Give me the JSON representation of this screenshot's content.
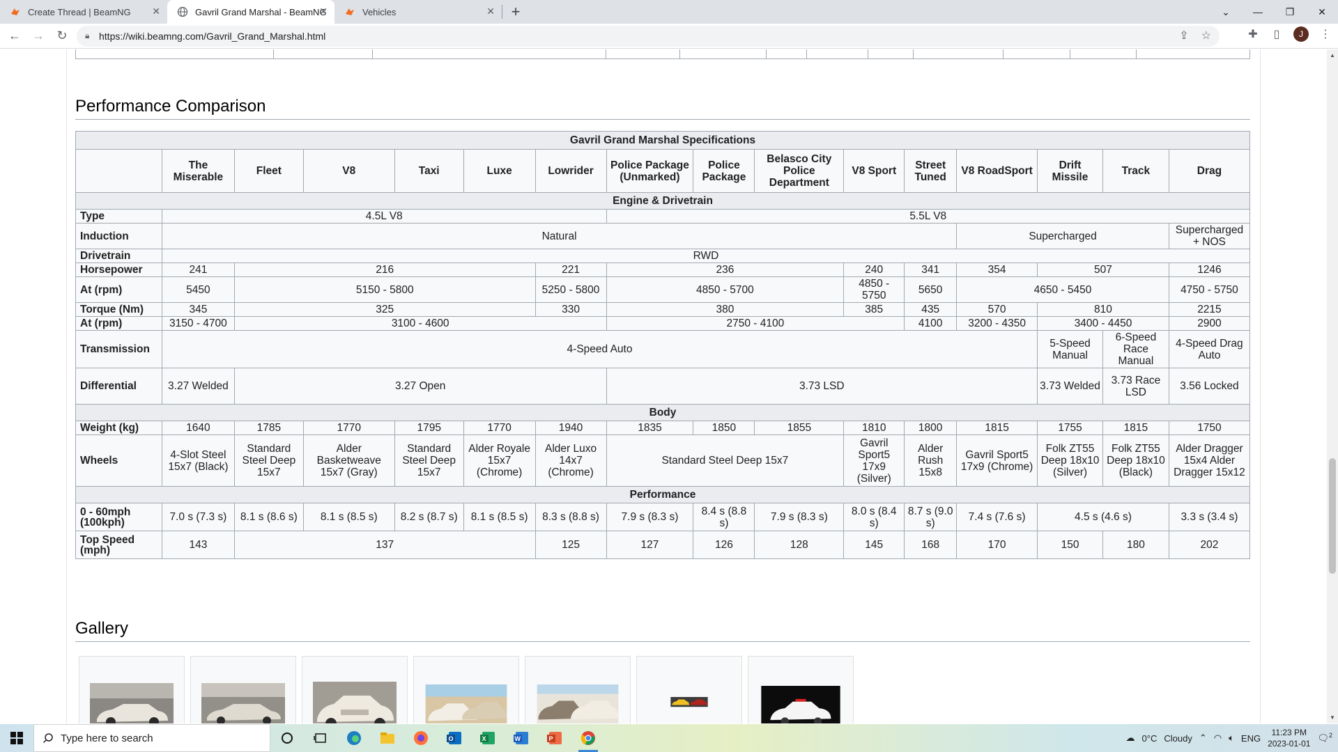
{
  "browser": {
    "tabs": [
      {
        "title": "Create Thread | BeamNG",
        "active": false
      },
      {
        "title": "Gavril Grand Marshal - BeamNG",
        "active": true
      },
      {
        "title": "Vehicles",
        "active": false
      }
    ],
    "url": "https://wiki.beamng.com/Gavril_Grand_Marshal.html",
    "profile_initial": "J"
  },
  "page": {
    "section_performance": "Performance Comparison",
    "section_gallery": "Gallery"
  },
  "spec_table": {
    "title": "Gavril Grand Marshal Specifications",
    "columns": [
      "The Miserable",
      "Fleet",
      "V8",
      "Taxi",
      "Luxe",
      "Lowrider",
      "Police Package (Unmarked)",
      "Police Package",
      "Belasco City Police Department",
      "V8 Sport",
      "Street Tuned",
      "V8 RoadSport",
      "Drift Missile",
      "Track",
      "Drag"
    ],
    "groups": {
      "engine": "Engine & Drivetrain",
      "body": "Body",
      "performance": "Performance"
    },
    "row_labels": {
      "type": "Type",
      "induction": "Induction",
      "drivetrain": "Drivetrain",
      "horsepower": "Horsepower",
      "hp_rpm": "At (rpm)",
      "torque": "Torque (Nm)",
      "tq_rpm": "At (rpm)",
      "transmission": "Transmission",
      "differential": "Differential",
      "weight": "Weight (kg)",
      "wheels": "Wheels",
      "accel": "0 - 60mph (100kph)",
      "topspeed": "Top Speed (mph)"
    },
    "rows": {
      "type": [
        {
          "text": "4.5L V8",
          "span": 6
        },
        {
          "text": "5.5L V8",
          "span": 9
        }
      ],
      "induction": [
        {
          "text": "Natural",
          "span": 11
        },
        {
          "text": "Supercharged",
          "span": 3
        },
        {
          "text": "Supercharged + NOS",
          "span": 1
        }
      ],
      "drivetrain": [
        {
          "text": "RWD",
          "span": 15
        }
      ],
      "horsepower": [
        {
          "text": "241",
          "span": 1
        },
        {
          "text": "216",
          "span": 4
        },
        {
          "text": "221",
          "span": 1
        },
        {
          "text": "236",
          "span": 3
        },
        {
          "text": "240",
          "span": 1
        },
        {
          "text": "341",
          "span": 1
        },
        {
          "text": "354",
          "span": 1
        },
        {
          "text": "507",
          "span": 2
        },
        {
          "text": "1246",
          "span": 1
        }
      ],
      "hp_rpm": [
        {
          "text": "5450",
          "span": 1
        },
        {
          "text": "5150 - 5800",
          "span": 4
        },
        {
          "text": "5250 - 5800",
          "span": 1
        },
        {
          "text": "4850 - 5700",
          "span": 3
        },
        {
          "text": "4850 - 5750",
          "span": 1
        },
        {
          "text": "5650",
          "span": 1
        },
        {
          "text": "4650 - 5450",
          "span": 3
        },
        {
          "text": "4750 - 5750",
          "span": 1
        }
      ],
      "torque": [
        {
          "text": "345",
          "span": 1
        },
        {
          "text": "325",
          "span": 4
        },
        {
          "text": "330",
          "span": 1
        },
        {
          "text": "380",
          "span": 3
        },
        {
          "text": "385",
          "span": 1
        },
        {
          "text": "435",
          "span": 1
        },
        {
          "text": "570",
          "span": 1
        },
        {
          "text": "810",
          "span": 2
        },
        {
          "text": "2215",
          "span": 1
        }
      ],
      "tq_rpm": [
        {
          "text": "3150 - 4700",
          "span": 1
        },
        {
          "text": "3100 - 4600",
          "span": 5
        },
        {
          "text": "2750 - 4100",
          "span": 4
        },
        {
          "text": "4100",
          "span": 1
        },
        {
          "text": "3200 - 4350",
          "span": 1
        },
        {
          "text": "3400 - 4450",
          "span": 2
        },
        {
          "text": "2900",
          "span": 1
        }
      ],
      "transmission": [
        {
          "text": "4-Speed Auto",
          "span": 12
        },
        {
          "text": "5-Speed Manual",
          "span": 1
        },
        {
          "text": "6-Speed Race Manual",
          "span": 1
        },
        {
          "text": "4-Speed Drag Auto",
          "span": 1
        }
      ],
      "differential": [
        {
          "text": "3.27 Welded",
          "span": 1
        },
        {
          "text": "3.27 Open",
          "span": 5
        },
        {
          "text": "3.73 LSD",
          "span": 6
        },
        {
          "text": "3.73 Welded",
          "span": 1
        },
        {
          "text": "3.73 Race LSD",
          "span": 1
        },
        {
          "text": "3.56 Locked",
          "span": 1
        }
      ],
      "weight": [
        {
          "text": "1640",
          "span": 1
        },
        {
          "text": "1785",
          "span": 1
        },
        {
          "text": "1770",
          "span": 1
        },
        {
          "text": "1795",
          "span": 1
        },
        {
          "text": "1770",
          "span": 1
        },
        {
          "text": "1940",
          "span": 1
        },
        {
          "text": "1835",
          "span": 1
        },
        {
          "text": "1850",
          "span": 1
        },
        {
          "text": "1855",
          "span": 1
        },
        {
          "text": "1810",
          "span": 1
        },
        {
          "text": "1800",
          "span": 1
        },
        {
          "text": "1815",
          "span": 1
        },
        {
          "text": "1755",
          "span": 1
        },
        {
          "text": "1815",
          "span": 1
        },
        {
          "text": "1750",
          "span": 1
        }
      ],
      "wheels": [
        {
          "text": "4-Slot Steel 15x7 (Black)",
          "span": 1
        },
        {
          "text": "Standard Steel Deep 15x7",
          "span": 1
        },
        {
          "text": "Alder Basketweave 15x7 (Gray)",
          "span": 1
        },
        {
          "text": "Standard Steel Deep 15x7",
          "span": 1
        },
        {
          "text": "Alder Royale 15x7 (Chrome)",
          "span": 1
        },
        {
          "text": "Alder Luxo 14x7 (Chrome)",
          "span": 1
        },
        {
          "text": "Standard Steel Deep 15x7",
          "span": 3
        },
        {
          "text": "Gavril Sport5 17x9 (Silver)",
          "span": 1
        },
        {
          "text": "Alder Rush 15x8",
          "span": 1
        },
        {
          "text": "Gavril Sport5 17x9 (Chrome)",
          "span": 1
        },
        {
          "text": "Folk ZT55 Deep 18x10 (Silver)",
          "span": 1
        },
        {
          "text": "Folk ZT55 Deep 18x10 (Black)",
          "span": 1
        },
        {
          "text": "Alder Dragger 15x4 Alder Dragger 15x12",
          "span": 1
        }
      ],
      "accel": [
        {
          "text": "7.0 s (7.3 s)",
          "span": 1
        },
        {
          "text": "8.1 s (8.6 s)",
          "span": 1
        },
        {
          "text": "8.1 s (8.5 s)",
          "span": 1
        },
        {
          "text": "8.2 s (8.7 s)",
          "span": 1
        },
        {
          "text": "8.1 s (8.5 s)",
          "span": 1
        },
        {
          "text": "8.3 s (8.8 s)",
          "span": 1
        },
        {
          "text": "7.9 s (8.3 s)",
          "span": 1
        },
        {
          "text": "8.4 s (8.8 s)",
          "span": 1
        },
        {
          "text": "7.9 s (8.3 s)",
          "span": 1
        },
        {
          "text": "8.0 s (8.4 s)",
          "span": 1
        },
        {
          "text": "8.7 s (9.0 s)",
          "span": 1
        },
        {
          "text": "7.4 s (7.6 s)",
          "span": 1
        },
        {
          "text": "4.5 s (4.6 s)",
          "span": 2
        },
        {
          "text": "3.3 s (3.4 s)",
          "span": 1
        }
      ],
      "topspeed": [
        {
          "text": "143",
          "span": 1
        },
        {
          "text": "137",
          "span": 4
        },
        {
          "text": "125",
          "span": 1
        },
        {
          "text": "127",
          "span": 1
        },
        {
          "text": "126",
          "span": 1
        },
        {
          "text": "128",
          "span": 1
        },
        {
          "text": "145",
          "span": 1
        },
        {
          "text": "168",
          "span": 1
        },
        {
          "text": "170",
          "span": 1
        },
        {
          "text": "150",
          "span": 1
        },
        {
          "text": "180",
          "span": 1
        },
        {
          "text": "202",
          "span": 1
        }
      ]
    }
  },
  "taskbar": {
    "search_placeholder": "Type here to search",
    "weather_temp": "0°C",
    "weather_text": "Cloudy",
    "language": "ENG",
    "time": "11:23 PM",
    "date": "2023-01-01",
    "notification_count": "2"
  },
  "colors": {
    "table_border": "#a2a9b1",
    "table_bg": "#f8f9fa",
    "table_header_bg": "#eaecf0",
    "chrome_tab_bg": "#dee1e6"
  },
  "icons": {
    "tab_favicon_beamng": "beamng-logo-icon",
    "tab_favicon_wiki": "globe-icon",
    "nav": [
      "back-arrow-icon",
      "forward-arrow-icon",
      "reload-icon",
      "lock-icon"
    ],
    "toolbar_right": [
      "share-icon",
      "star-icon",
      "puzzle-icon",
      "sidebar-icon"
    ],
    "taskbar_apps": [
      "cortana-icon",
      "task-view-icon",
      "edge-icon",
      "file-explorer-icon",
      "firefox-icon",
      "outlook-icon",
      "excel-icon",
      "word-icon",
      "powerpoint-icon",
      "chrome-icon"
    ]
  }
}
